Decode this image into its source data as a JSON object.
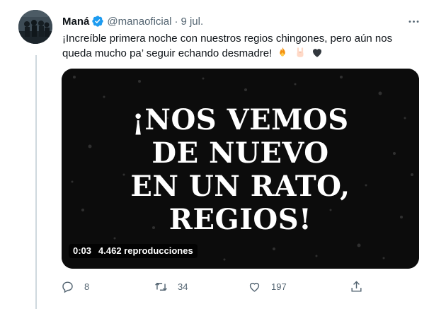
{
  "tweet": {
    "author": {
      "display_name": "Maná",
      "handle": "@manaoficial",
      "separator": "·",
      "date": "9 jul.",
      "verified": true
    },
    "text": "¡Increíble primera noche con nuestros regios chingones, pero aún nos queda mucho pa’ seguir echando desmadre!",
    "emojis": [
      "fire-emoji",
      "rock-on-hand-emoji",
      "black-heart-emoji"
    ],
    "media": {
      "overlay_lines": [
        "¡NOS VEMOS",
        "DE NUEVO",
        "EN UN RATO,",
        "REGIOS!"
      ],
      "duration": "0:03",
      "views": "4.462 reproducciones"
    },
    "actions": {
      "reply_count": "8",
      "retweet_count": "34",
      "like_count": "197"
    }
  },
  "colors": {
    "text_primary": "#0f1419",
    "text_secondary": "#536471",
    "verified_blue": "#1d9bf0",
    "thread_line": "#cfd9de"
  }
}
